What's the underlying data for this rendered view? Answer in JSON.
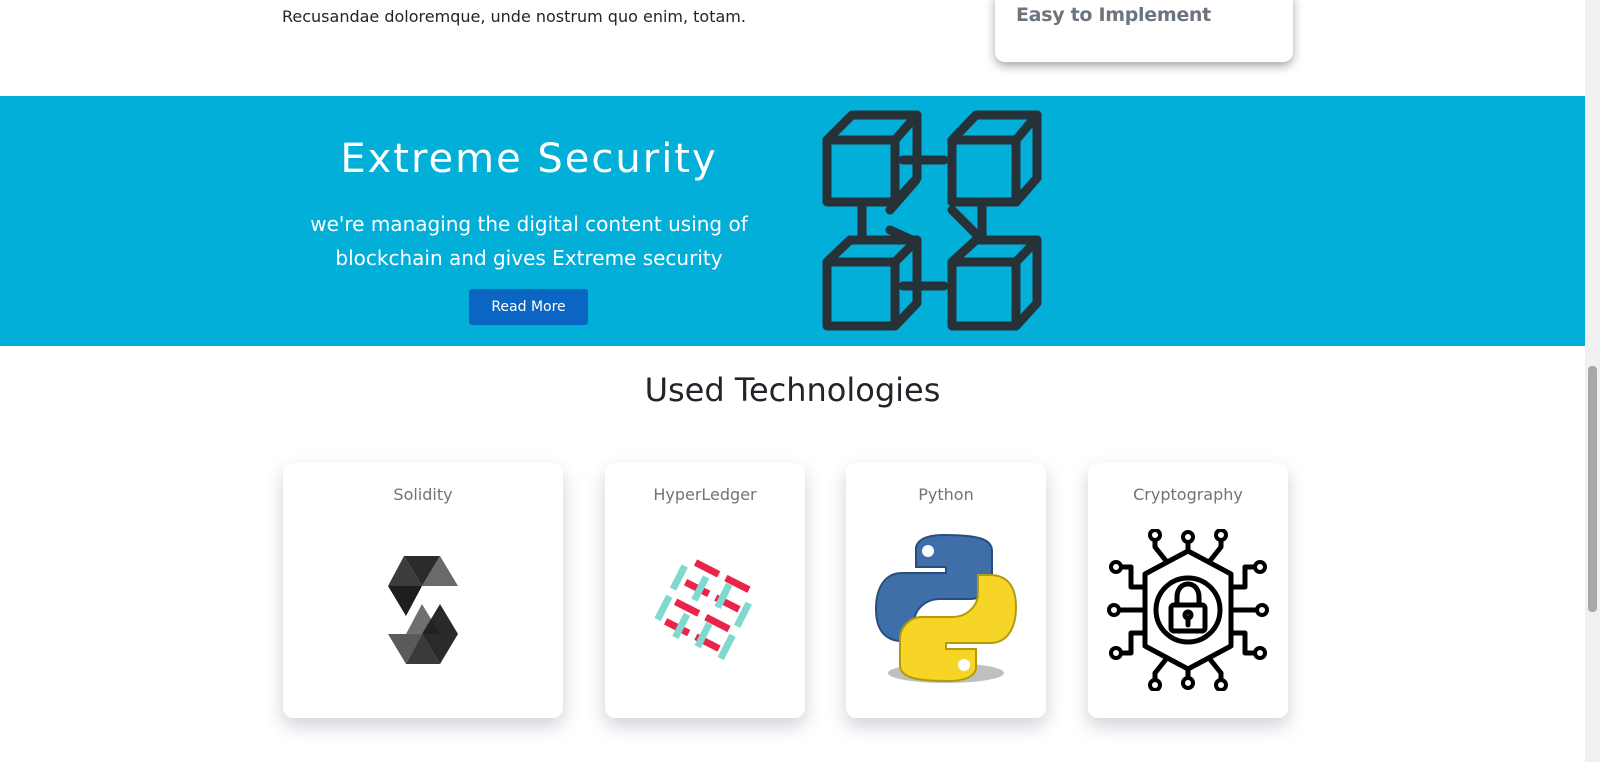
{
  "intro": {
    "text": "Recusandae doloremque, unde nostrum quo enim, totam."
  },
  "feature_card": {
    "title": "Easy to Implement"
  },
  "security": {
    "title": "Extreme Security",
    "line1": "we're managing the digital content using of",
    "line2": "blockchain and gives Extreme security",
    "button": "Read More",
    "background": "#02afd9",
    "icon": "blockchain-icon"
  },
  "technologies": {
    "title": "Used Technologies",
    "items": [
      {
        "name": "Solidity",
        "icon": "solidity-logo-icon"
      },
      {
        "name": "HyperLedger",
        "icon": "hyperledger-logo-icon"
      },
      {
        "name": "Python",
        "icon": "python-logo-icon"
      },
      {
        "name": "Cryptography",
        "icon": "cryptography-lock-icon"
      }
    ]
  }
}
